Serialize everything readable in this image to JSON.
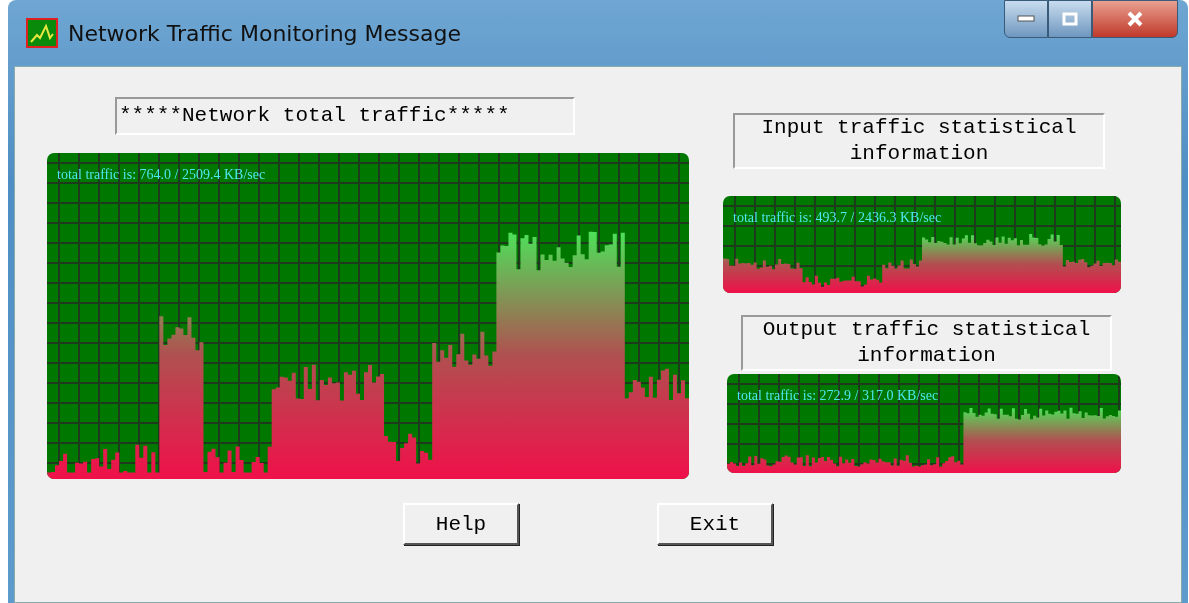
{
  "window": {
    "title": "Network Traffic Monitoring Message"
  },
  "total": {
    "heading": "*****Network total traffic*****",
    "graph_caption": "total traffic is: 764.0 / 2509.4 KB/sec"
  },
  "input": {
    "heading": "Input traffic statistical information",
    "graph_caption": "total traffic is: 493.7 / 2436.3 KB/sec"
  },
  "output": {
    "heading": "Output traffic statistical information",
    "graph_caption": "total traffic is: 272.9 / 317.0 KB/sec"
  },
  "buttons": [
    "Help",
    "Exit"
  ]
}
